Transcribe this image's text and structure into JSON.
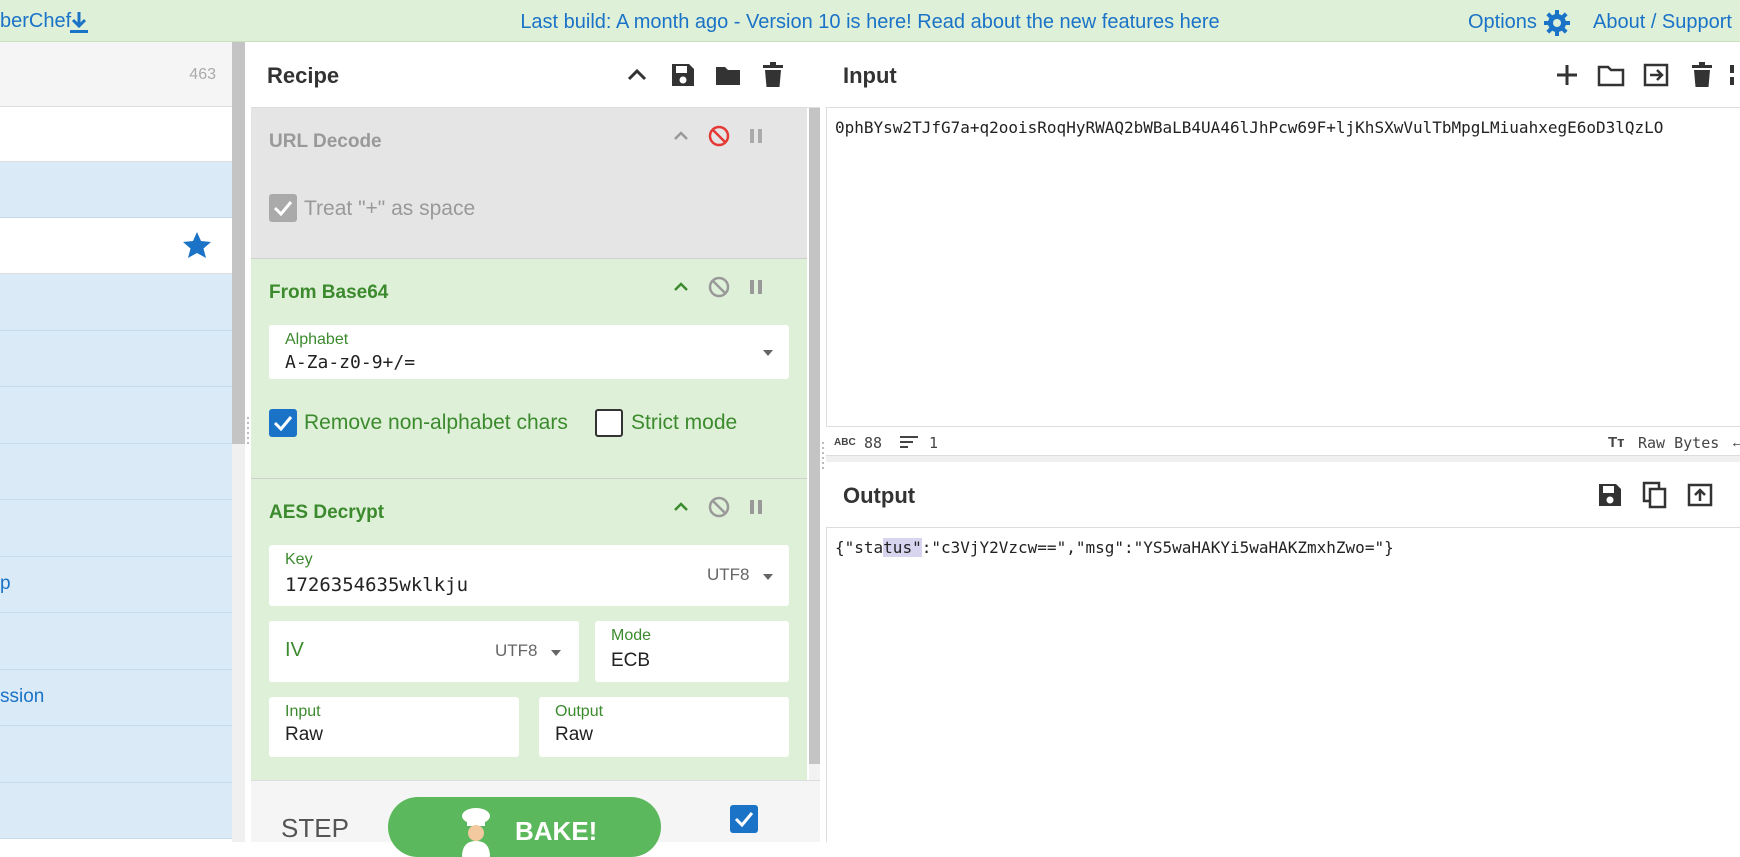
{
  "banner": {
    "brand": "berChef",
    "notice": "Last build: A month ago - Version 10 is here! Read about the new features ",
    "notice_link": "here",
    "options": "Options",
    "about": "About / Support"
  },
  "operations": {
    "count": "463",
    "visible_items": [
      "",
      "",
      "",
      "",
      "",
      "p",
      "",
      "ssion",
      "",
      ""
    ]
  },
  "recipe": {
    "title": "Recipe",
    "ops": {
      "url_decode": {
        "name": "URL Decode",
        "treat_plus_label": "Treat \"+\" as space",
        "treat_plus_checked": true,
        "disabled": true
      },
      "from_base64": {
        "name": "From Base64",
        "alphabet_label": "Alphabet",
        "alphabet_value": "A-Za-z0-9+/=",
        "remove_label": "Remove non-alphabet chars",
        "remove_checked": true,
        "strict_label": "Strict mode",
        "strict_checked": false
      },
      "aes_decrypt": {
        "name": "AES Decrypt",
        "key_label": "Key",
        "key_value": "1726354635wklkju",
        "key_encoding": "UTF8",
        "iv_label": "IV",
        "iv_encoding": "UTF8",
        "mode_label": "Mode",
        "mode_value": "ECB",
        "input_label": "Input",
        "input_value": "Raw",
        "output_label": "Output",
        "output_value": "Raw"
      }
    },
    "step_label": "STEP",
    "bake_label": "BAKE!",
    "auto_bake_checked": true
  },
  "input": {
    "title": "Input",
    "text": "0phBYsw2TJfG7a+q2ooisRoqHyRWAQ2bWBaLB4UA46lJhPcw69F+ljKhSXwVulTbMpgLMiuahxegE6oD3lQzLO",
    "chars": "88",
    "lines": "1",
    "encoding": "Raw Bytes"
  },
  "output": {
    "title": "Output",
    "text_pre": "{\"sta",
    "text_hl": "tus\"",
    "text_post": ":\"c3VjY2Vzcw==\",\"msg\":\"YS5waHAKYi5waHAKZmxhZwo=\"}"
  },
  "colors": {
    "banner_bg": "#dff0d8",
    "link": "#1a73c7",
    "op_enabled_bg": "#dff0d8",
    "op_disabled_bg": "#e5e5e5",
    "bake_green": "#5cb85c"
  }
}
